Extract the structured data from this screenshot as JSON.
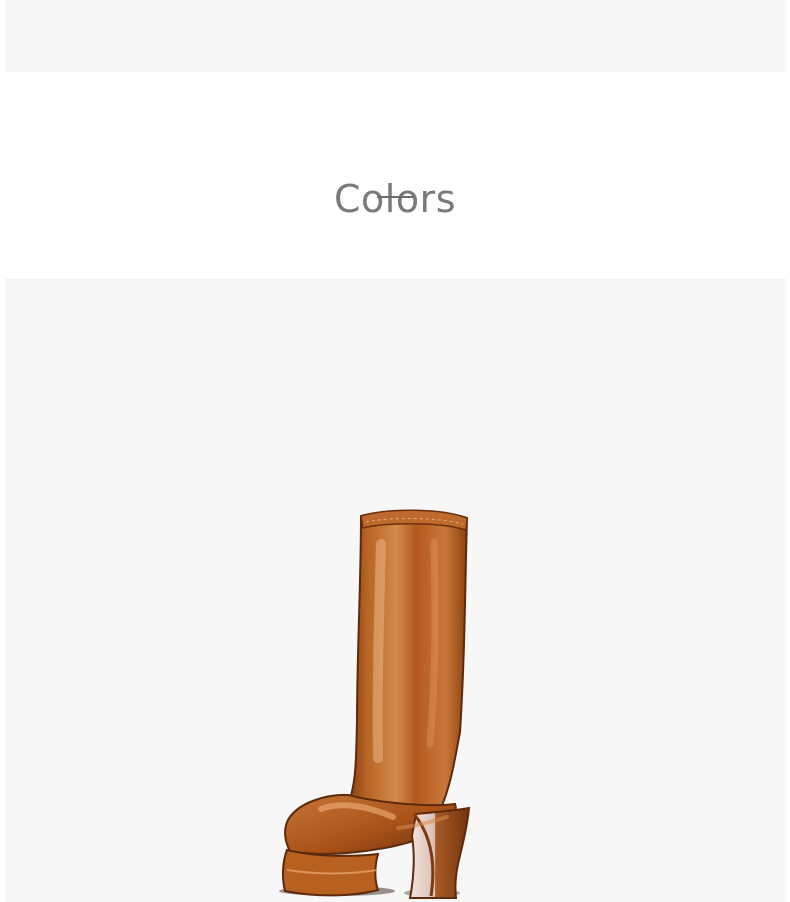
{
  "page": {
    "background": "#ffffff",
    "panel_background": "#f7f7f7"
  },
  "section": {
    "title": "Colors",
    "title_color": "#7a7a7a",
    "underline_color": "#6d6d6d"
  },
  "product_image": {
    "subject": "boot-icon",
    "primary_color": "#b35d20",
    "shadow_color": "#6f3310",
    "highlight_color": "#e7a36c",
    "inner_heel_color": "#f2ddd4"
  }
}
